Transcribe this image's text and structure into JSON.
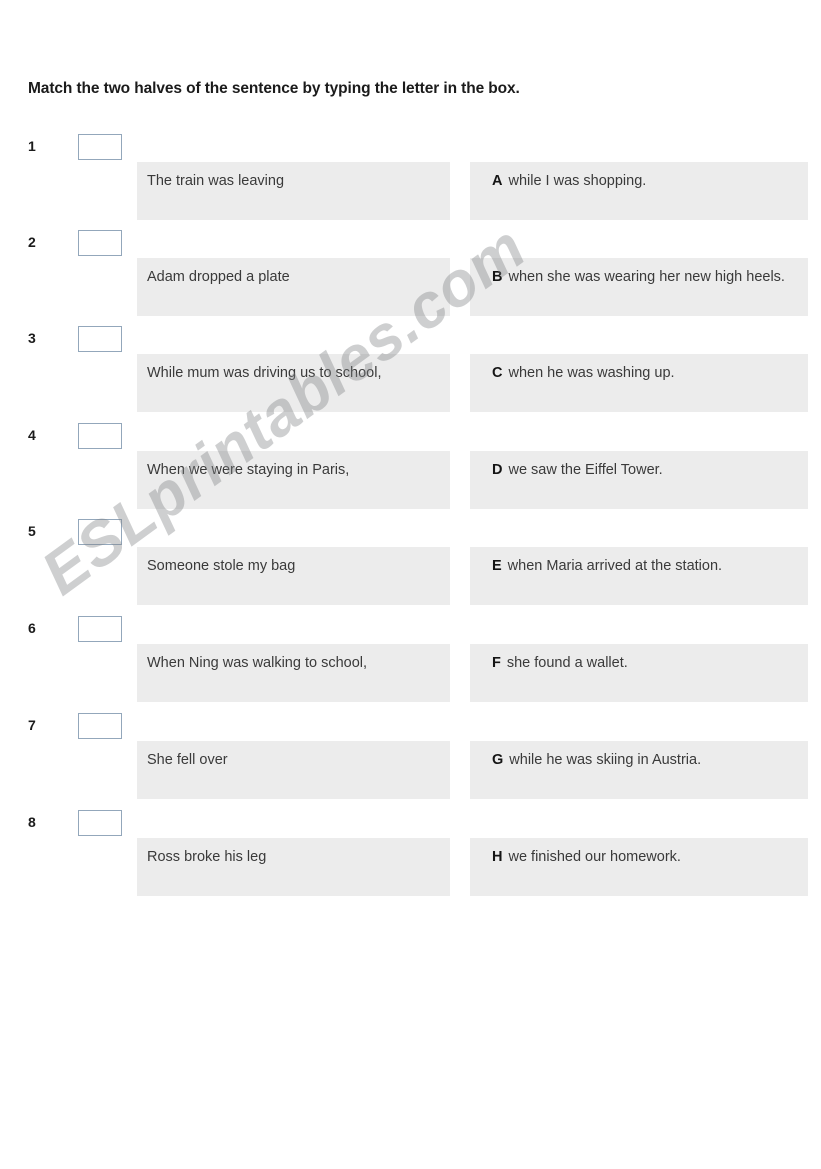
{
  "worksheet": {
    "title": "Match the two halves of the sentence by typing the letter in the box.",
    "watermark": "ESLprintables.com",
    "accent_border_color": "#93a7bb",
    "panel_background_color": "#ececec",
    "text_color": "#3a3a3a"
  },
  "rows": [
    {
      "number": "1",
      "answer": "",
      "left_text": "The train was leaving",
      "letter": "A",
      "right_text": "while I was shopping."
    },
    {
      "number": "2",
      "answer": "",
      "left_text": "Adam dropped a plate",
      "letter": "B",
      "right_text": "when she was wearing her new high heels."
    },
    {
      "number": "3",
      "answer": "",
      "left_text": "While mum was driving us to school,",
      "letter": "C",
      "right_text": "when he was washing up."
    },
    {
      "number": "4",
      "answer": "",
      "left_text": "When we were staying in Paris,",
      "letter": "D",
      "right_text": "we saw the Eiffel Tower."
    },
    {
      "number": "5",
      "answer": "",
      "left_text": "Someone stole my bag",
      "letter": "E",
      "right_text": "when Maria arrived at the station."
    },
    {
      "number": "6",
      "answer": "",
      "left_text": "When Ning was walking to school,",
      "letter": "F",
      "right_text": "she found a wallet."
    },
    {
      "number": "7",
      "answer": "",
      "left_text": "She fell over",
      "letter": "G",
      "right_text": "while he was skiing in Austria."
    },
    {
      "number": "8",
      "answer": "",
      "left_text": "Ross broke his leg",
      "letter": "H",
      "right_text": "we finished our homework."
    }
  ]
}
